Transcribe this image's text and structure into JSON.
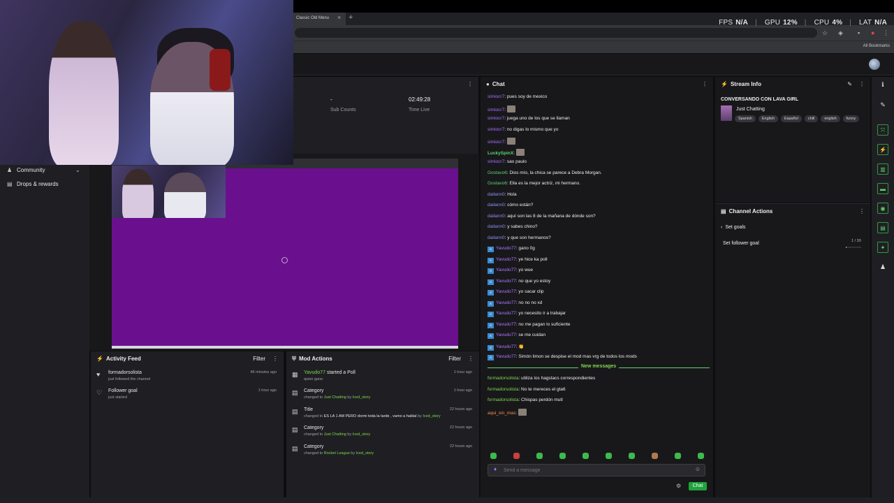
{
  "browser": {
    "tab_title": "Classic Old Menu",
    "tab_close": "×",
    "new_tab": "+",
    "bookmarks_label": "All Bookmarks"
  },
  "stats_overlay": {
    "fps_label": "FPS",
    "fps_value": "N/A",
    "gpu_label": "GPU",
    "gpu_value": "12%",
    "cpu_label": "CPU",
    "cpu_value": "4%",
    "lat_label": "LAT",
    "lat_value": "N/A"
  },
  "sidebar": {
    "items": [
      {
        "label": "Community",
        "icon": "community-icon"
      },
      {
        "label": "Drops & rewards",
        "icon": "drops-icon"
      }
    ]
  },
  "stream_stats": {
    "sub_counts_value": "-",
    "sub_counts_label": "Sub Counts",
    "time_live_value": "02:49:28",
    "time_live_label": "Time Live"
  },
  "activity_feed": {
    "title": "Activity Feed",
    "filter": "Filter",
    "items": [
      {
        "title": "formadorsolista",
        "sub": "just followed the channel",
        "when": "46 minutes ago",
        "icon": "heart-filled-icon"
      },
      {
        "title": "Follower goal",
        "sub": "just started",
        "when": "1 hour ago",
        "icon": "heart-outline-icon"
      }
    ]
  },
  "mod_actions": {
    "title": "Mod Actions",
    "filter": "Filter",
    "items": [
      {
        "title_user": "Yavudo77",
        "title_rest": " started a Poll",
        "sub": "quien gano",
        "when": "1 hour ago"
      },
      {
        "title": "Category",
        "sub_pre": "changed to ",
        "sub_val": "Just Chatting",
        "sub_mid": " by ",
        "sub_user": "Iced_story",
        "when": "1 hour ago"
      },
      {
        "title": "Title",
        "sub_pre": "changed to ",
        "sub_val": "ES LA 1 AM PERO dormi toda la tarde , vamo a hablal",
        "sub_mid": " by ",
        "sub_user": "Iced_story",
        "when": "22 hours ago"
      },
      {
        "title": "Category",
        "sub_pre": "changed to ",
        "sub_val": "Just Chatting",
        "sub_mid": " by ",
        "sub_user": "Iced_story",
        "when": "22 hours ago"
      },
      {
        "title": "Category",
        "sub_pre": "changed to ",
        "sub_val": "Rocket League",
        "sub_mid": " by ",
        "sub_user": "Iced_story",
        "when": "22 hours ago"
      }
    ]
  },
  "chat": {
    "title": "Chat",
    "new_messages": "New messages",
    "placeholder": "Send a message",
    "send_label": "Chat",
    "messages": [
      {
        "user": "simiocr7",
        "text": ": pues soy de mexico",
        "cls": "u-sim"
      },
      {
        "user": "simiocr7",
        "text": ": ",
        "cls": "u-sim",
        "emote": true
      },
      {
        "user": "simiocr7",
        "text": ": juega uno de los que se llaman",
        "cls": "u-sim"
      },
      {
        "user": "simiocr7",
        "text": ": no digas lo mismo que yo",
        "cls": "u-sim"
      },
      {
        "user": "simiocr7",
        "text": ": ",
        "cls": "u-sim",
        "emote": true
      },
      {
        "user": "LuckySpinX",
        "text": ": ",
        "cls": "u-lucky",
        "emote": true
      },
      {
        "user": "simiocr7",
        "text": ": sao paulo",
        "cls": "u-sim"
      },
      {
        "user": "Gostavo6",
        "text": ": Dios mío, la chica se parece a Debra Morgan.",
        "cls": "u-gos"
      },
      {
        "user": "Gostavo6",
        "text": ": Ella es la mejor actriz, mi hermano.",
        "cls": "u-gos"
      },
      {
        "user": "dailann0",
        "text": ": Hola",
        "cls": "u-dai"
      },
      {
        "user": "dailann0",
        "text": ": cómo están?",
        "cls": "u-dai"
      },
      {
        "user": "dailann0",
        "text": ": aquí son las 8 de la mañana de dónde son?",
        "cls": "u-dai"
      },
      {
        "user": "dailann0",
        "text": ": y sabes chino?",
        "cls": "u-dai"
      },
      {
        "user": "dailann0",
        "text": ": y que son hermanos?",
        "cls": "u-dai"
      },
      {
        "user": "Yavudo77",
        "text": ": gano 0g",
        "cls": "u-yav",
        "badge": true
      },
      {
        "user": "Yavudo77",
        "text": ": ye hice ka poll",
        "cls": "u-yav",
        "badge": true
      },
      {
        "user": "Yavudo77",
        "text": ": yo wue",
        "cls": "u-yav",
        "badge": true
      },
      {
        "user": "Yavudo77",
        "text": ": no que yo estoy",
        "cls": "u-yav",
        "badge": true
      },
      {
        "user": "Yavudo77",
        "text": ": yo sacar clip",
        "cls": "u-yav",
        "badge": true
      },
      {
        "user": "Yavudo77",
        "text": ": no no no xd",
        "cls": "u-yav",
        "badge": true
      },
      {
        "user": "Yavudo77",
        "text": ": yo necesito ir a trabajar",
        "cls": "u-yav",
        "badge": true
      },
      {
        "user": "Yavudo77",
        "text": ": no me pagan lo suficiente",
        "cls": "u-yav",
        "badge": true
      },
      {
        "user": "Yavudo77",
        "text": ": se me cuidan",
        "cls": "u-yav",
        "badge": true
      },
      {
        "user": "Yavudo77",
        "text": ": 👏",
        "cls": "u-yav",
        "badge": true
      },
      {
        "user": "Yavudo77",
        "text": ": Simón limon se despise el mod mas vrg de todos los mods",
        "cls": "u-yav",
        "badge": true
      }
    ],
    "new_section": [
      {
        "user": "formadorsolista",
        "text": ": utiliza los hagstacs correspondientes",
        "cls": "u-form"
      },
      {
        "user": "formadorsolista",
        "text": ": No te mereces el gta6",
        "cls": "u-form"
      },
      {
        "user": "formadorsolista",
        "text": ": Chispas perdón mutl",
        "cls": "u-form"
      },
      {
        "user": "aqui_sin_mas",
        "text": ": ",
        "cls": "u-aqui",
        "emote": true
      }
    ]
  },
  "stream_info": {
    "title": "Stream Info",
    "stream_title": "CONVERSANDO CON LAVA GIRL",
    "category": "Just Chatting",
    "tags": [
      "Spanish",
      "English",
      "Español",
      "chill",
      "english",
      "funny"
    ]
  },
  "channel_actions": {
    "title": "Channel Actions",
    "back_label": "Set goals",
    "goal_label": "Set follower goal",
    "goal_current": "1",
    "goal_total": "/ 30",
    "goal_fraction": 0.033
  }
}
